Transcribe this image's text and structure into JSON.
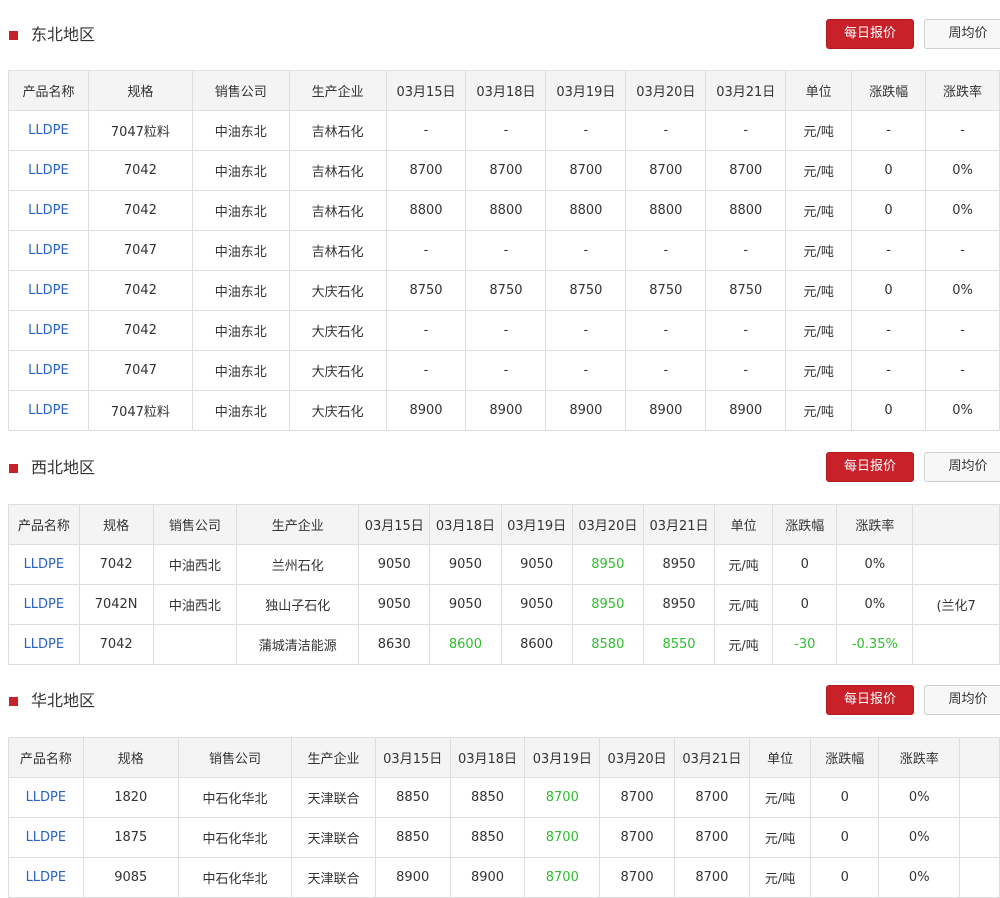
{
  "sections": [
    {
      "title": "东北地区",
      "buttons": {
        "daily": "每日报价",
        "weekly": "周均价"
      },
      "headers": [
        "产品名称",
        "规格",
        "销售公司",
        "生产企业",
        "03月15日",
        "03月18日",
        "03月19日",
        "03月20日",
        "03月21日",
        "单位",
        "涨跌幅",
        "涨跌率"
      ],
      "rows": [
        [
          "LLDPE",
          "7047粒料",
          "中油东北",
          "吉林石化",
          "-",
          "-",
          "-",
          "-",
          "-",
          "元/吨",
          "-",
          "-"
        ],
        [
          "LLDPE",
          "7042",
          "中油东北",
          "吉林石化",
          "8700",
          "8700",
          "8700",
          "8700",
          "8700",
          "元/吨",
          "0",
          "0%"
        ],
        [
          "LLDPE",
          "7042",
          "中油东北",
          "吉林石化",
          "8800",
          "8800",
          "8800",
          "8800",
          "8800",
          "元/吨",
          "0",
          "0%"
        ],
        [
          "LLDPE",
          "7047",
          "中油东北",
          "吉林石化",
          "-",
          "-",
          "-",
          "-",
          "-",
          "元/吨",
          "-",
          "-"
        ],
        [
          "LLDPE",
          "7042",
          "中油东北",
          "大庆石化",
          "8750",
          "8750",
          "8750",
          "8750",
          "8750",
          "元/吨",
          "0",
          "0%"
        ],
        [
          "LLDPE",
          "7042",
          "中油东北",
          "大庆石化",
          "-",
          "-",
          "-",
          "-",
          "-",
          "元/吨",
          "-",
          "-"
        ],
        [
          "LLDPE",
          "7047",
          "中油东北",
          "大庆石化",
          "-",
          "-",
          "-",
          "-",
          "-",
          "元/吨",
          "-",
          "-"
        ],
        [
          "LLDPE",
          "7047粒料",
          "中油东北",
          "大庆石化",
          "8900",
          "8900",
          "8900",
          "8900",
          "8900",
          "元/吨",
          "0",
          "0%"
        ]
      ]
    },
    {
      "title": "西北地区",
      "buttons": {
        "daily": "每日报价",
        "weekly": "周均价"
      },
      "headers": [
        "产品名称",
        "规格",
        "销售公司",
        "生产企业",
        "03月15日",
        "03月18日",
        "03月19日",
        "03月20日",
        "03月21日",
        "单位",
        "涨跌幅",
        "涨跌率",
        ""
      ],
      "rows": [
        [
          "LLDPE",
          "7042",
          "中油西北",
          "兰州石化",
          "9050",
          "9050",
          "9050",
          "8950",
          "8950",
          "元/吨",
          "0",
          "0%",
          ""
        ],
        [
          "LLDPE",
          "7042N",
          "中油西北",
          "独山子石化",
          "9050",
          "9050",
          "9050",
          "8950",
          "8950",
          "元/吨",
          "0",
          "0%",
          "(兰化7"
        ],
        [
          "LLDPE",
          "7042",
          "",
          "蒲城清洁能源",
          "8630",
          "8600",
          "8600",
          "8580",
          "8550",
          "元/吨",
          "-30",
          "-0.35%",
          ""
        ]
      ],
      "green_cells": [
        [
          0,
          7
        ],
        [
          1,
          7
        ],
        [
          2,
          5
        ],
        [
          2,
          7
        ],
        [
          2,
          8
        ],
        [
          2,
          10
        ],
        [
          2,
          11
        ]
      ]
    },
    {
      "title": "华北地区",
      "buttons": {
        "daily": "每日报价",
        "weekly": "周均价"
      },
      "headers": [
        "产品名称",
        "规格",
        "销售公司",
        "生产企业",
        "03月15日",
        "03月18日",
        "03月19日",
        "03月20日",
        "03月21日",
        "单位",
        "涨跌幅",
        "涨跌率",
        ""
      ],
      "rows": [
        [
          "LLDPE",
          "1820",
          "中石化华北",
          "天津联合",
          "8850",
          "8850",
          "8700",
          "8700",
          "8700",
          "元/吨",
          "0",
          "0%",
          ""
        ],
        [
          "LLDPE",
          "1875",
          "中石化华北",
          "天津联合",
          "8850",
          "8850",
          "8700",
          "8700",
          "8700",
          "元/吨",
          "0",
          "0%",
          ""
        ],
        [
          "LLDPE",
          "9085",
          "中石化华北",
          "天津联合",
          "8900",
          "8900",
          "8700",
          "8700",
          "8700",
          "元/吨",
          "0",
          "0%",
          ""
        ]
      ],
      "green_cells": [
        [
          0,
          6
        ],
        [
          1,
          6
        ],
        [
          2,
          6
        ]
      ]
    }
  ],
  "colors": {
    "accent": "#c8212a",
    "link": "#2a62c9",
    "down": "#2fbd2f"
  }
}
